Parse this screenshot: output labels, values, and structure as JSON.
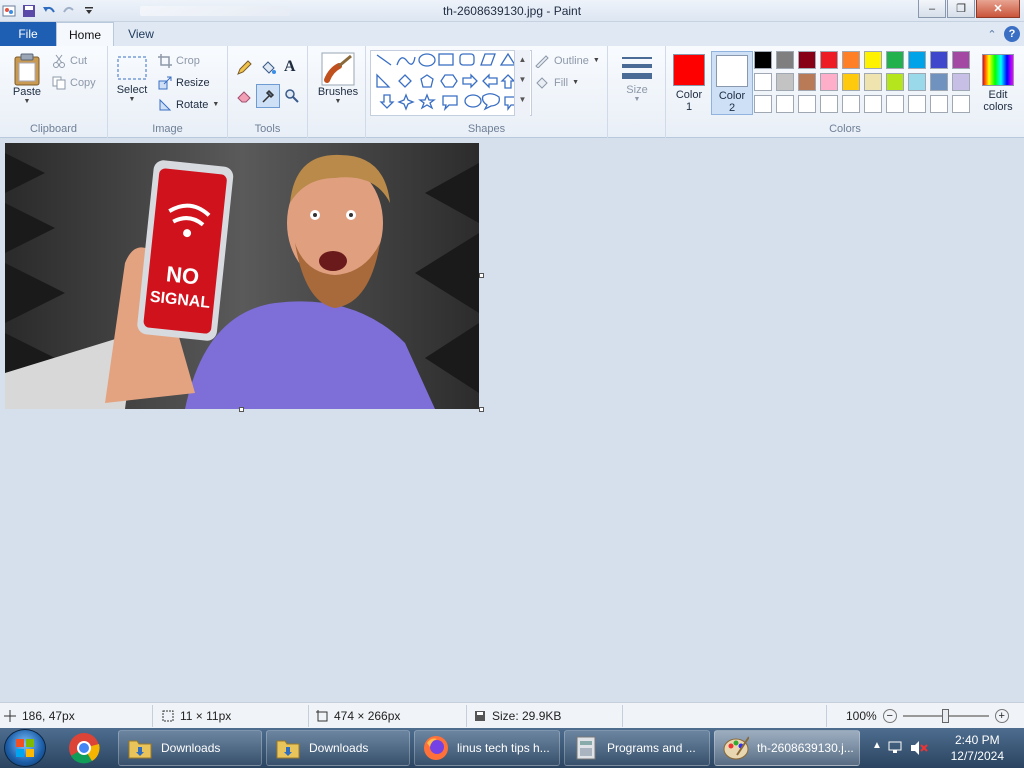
{
  "window": {
    "title": "th-2608639130.jpg - Paint",
    "controls": {
      "minimize": "–",
      "maximize": "❐",
      "close": "✕"
    }
  },
  "tabs": {
    "file": "File",
    "home": "Home",
    "view": "View"
  },
  "ribbon": {
    "clipboard": {
      "label": "Clipboard",
      "paste": "Paste",
      "cut": "Cut",
      "copy": "Copy"
    },
    "image": {
      "label": "Image",
      "select": "Select",
      "crop": "Crop",
      "resize": "Resize",
      "rotate": "Rotate"
    },
    "tools": {
      "label": "Tools"
    },
    "brushes": {
      "label": "Brushes"
    },
    "shapes": {
      "label": "Shapes",
      "outline": "Outline",
      "fill": "Fill"
    },
    "size": {
      "label": "Size"
    },
    "colors": {
      "label": "Colors",
      "color1_label": "Color",
      "color1_num": "1",
      "color2_label": "Color",
      "color2_num": "2",
      "edit_label": "Edit",
      "edit_label2": "colors",
      "color1": "#ff0000",
      "color2": "#ffffff",
      "palette": [
        "#000000",
        "#7f7f7f",
        "#880015",
        "#ed1c24",
        "#ff7f27",
        "#fff200",
        "#22b14c",
        "#00a2e8",
        "#3f48cc",
        "#a349a4",
        "#ffffff",
        "#c3c3c3",
        "#b97a57",
        "#ffaec9",
        "#ffc90e",
        "#efe4b0",
        "#b5e61d",
        "#99d9ea",
        "#7092be",
        "#c8bfe7",
        "#ffffff",
        "#ffffff",
        "#ffffff",
        "#ffffff",
        "#ffffff",
        "#ffffff",
        "#ffffff",
        "#ffffff",
        "#ffffff",
        "#ffffff"
      ]
    }
  },
  "canvas": {
    "phone_text_line1": "NO",
    "phone_text_line2": "SIGNAL"
  },
  "status": {
    "cursor_pos": "186, 47px",
    "selection_size": "11 × 11px",
    "image_size": "474 × 266px",
    "file_size": "Size: 29.9KB",
    "zoom": "100%",
    "zoom_fraction": 0.5
  },
  "taskbar": {
    "items": [
      {
        "label": "Downloads"
      },
      {
        "label": "Downloads"
      },
      {
        "label": "linus tech tips h..."
      },
      {
        "label": "Programs and ..."
      },
      {
        "label": "th-2608639130.j..."
      }
    ],
    "time": "2:40 PM",
    "date": "12/7/2024"
  }
}
